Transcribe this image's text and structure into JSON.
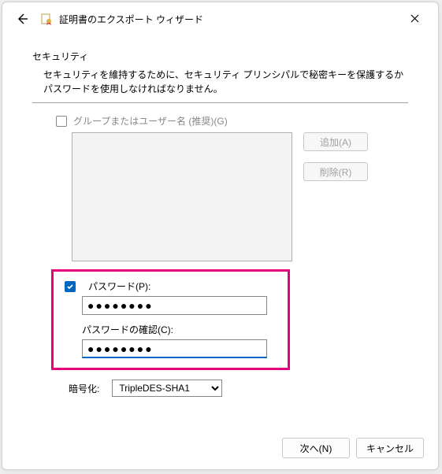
{
  "header": {
    "title": "証明書のエクスポート ウィザード"
  },
  "section": {
    "title": "セキュリティ",
    "description": "セキュリティを維持するために、セキュリティ プリンシパルで秘密キーを保護するかパスワードを使用しなければなりません。"
  },
  "group": {
    "checked": false,
    "label": "グループまたはユーザー名 (推奨)(G)"
  },
  "buttons": {
    "add": "追加(A)",
    "remove": "削除(R)",
    "next": "次へ(N)",
    "cancel": "キャンセル"
  },
  "password": {
    "checked": true,
    "label": "パスワード(P):",
    "value": "●●●●●●●●",
    "confirm_label": "パスワードの確認(C):",
    "confirm_value": "●●●●●●●●"
  },
  "encryption": {
    "label": "暗号化:",
    "value": "TripleDES-SHA1"
  }
}
